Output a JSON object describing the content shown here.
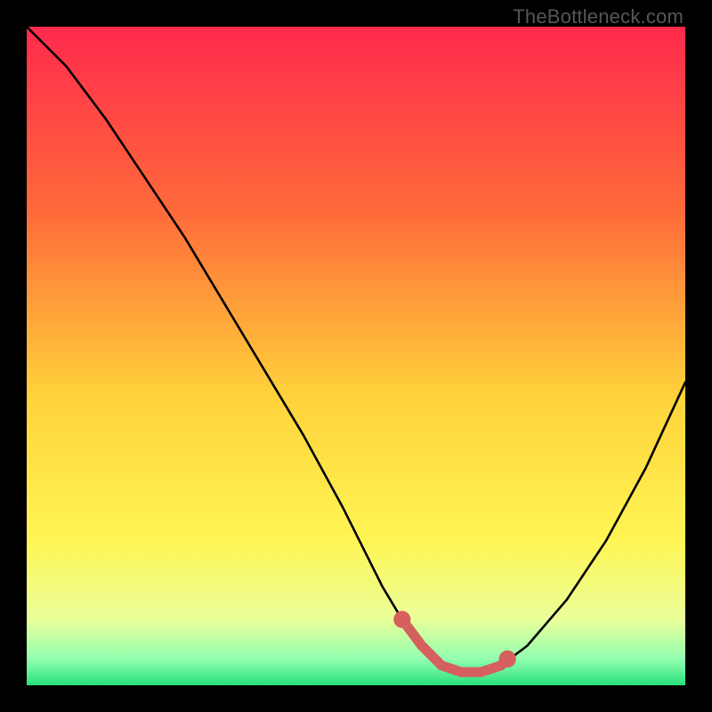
{
  "watermark": "TheBottleneck.com",
  "colors": {
    "frame": "#000000",
    "grad_top": "#ff2a4d",
    "grad_mid1": "#ff6a3a",
    "grad_mid2": "#ffd23a",
    "grad_mid3": "#fff554",
    "grad_low1": "#eaff9a",
    "grad_low2": "#93ffb0",
    "grad_bottom": "#28e07a",
    "curve": "#000000",
    "marker_fill": "#d5605e",
    "marker_stroke": "#d5605e"
  },
  "chart_data": {
    "type": "line",
    "title": "",
    "xlabel": "",
    "ylabel": "",
    "xlim": [
      0,
      100
    ],
    "ylim": [
      0,
      100
    ],
    "annotations": [],
    "series": [
      {
        "name": "bottleneck-curve",
        "x": [
          0,
          6,
          12,
          18,
          24,
          30,
          36,
          42,
          48,
          54,
          57,
          60,
          63,
          66,
          69,
          72,
          76,
          82,
          88,
          94,
          100
        ],
        "y": [
          100,
          94,
          86,
          77,
          68,
          58,
          48,
          38,
          27,
          15,
          10,
          6,
          3,
          2,
          2,
          3,
          6,
          13,
          22,
          33,
          46
        ]
      }
    ],
    "markers": [
      {
        "name": "highlight-left-end",
        "x": 57,
        "y": 10,
        "r": 1.3
      },
      {
        "name": "highlight-right-end",
        "x": 73,
        "y": 4,
        "r": 1.3
      }
    ],
    "highlight_segment": {
      "name": "low-bottleneck-range",
      "x": [
        57,
        60,
        63,
        66,
        69,
        72,
        73
      ],
      "y": [
        10,
        6,
        3,
        2,
        2,
        3,
        4
      ]
    }
  }
}
